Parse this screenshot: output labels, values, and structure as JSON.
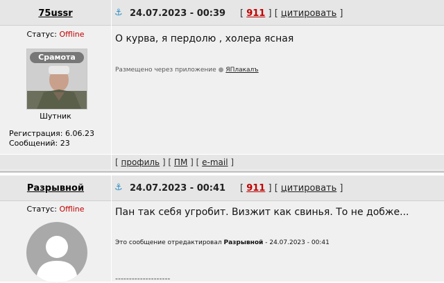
{
  "posts": [
    {
      "username": "75ussr",
      "status_label": "Статус:",
      "status_value": "Offline",
      "avatar_caption": "Срамота",
      "rank": "Шутник",
      "reg_label": "Регистрация:",
      "reg_value": "6.06.23",
      "msgs_label": "Сообщений:",
      "msgs_value": "23",
      "date": "24.07.2023 - 00:39",
      "num": "911",
      "quote": "цитировать",
      "text": "О курва, я пердолю , холера ясная",
      "posted_via": "Размещено через приложение",
      "app_name": "ЯПлакалъ",
      "footer_links": [
        "профиль",
        "ПМ",
        "e-mail"
      ]
    },
    {
      "username": "Разрывной",
      "status_label": "Статус:",
      "status_value": "Offline",
      "date": "24.07.2023 - 00:41",
      "num": "911",
      "quote": "цитировать",
      "text": "Пан так себя угробит. Визжит как свинья. То не добже...",
      "edit_prefix": "Это сообщение отредактировал",
      "edit_user": "Разрывной",
      "edit_date": "- 24.07.2023 - 00:41",
      "signature_line": "--------------------"
    }
  ],
  "colors": {
    "accent_red": "#c00000",
    "anchor_blue": "#2a8fc4",
    "row_bg": "#f0f0f0",
    "head_bg": "#e6e6e6"
  },
  "icons": {
    "anchor": "anchor-icon",
    "apple": "apple-icon"
  }
}
